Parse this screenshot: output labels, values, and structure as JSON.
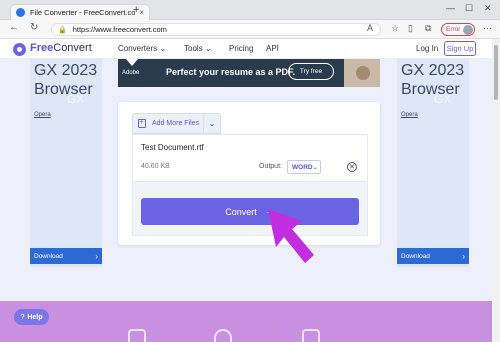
{
  "browser": {
    "tab_title": "File Converter - FreeConvert.com",
    "tab_close": "×",
    "new_tab": "+",
    "minimize": "—",
    "maximize": "☐",
    "close": "✕",
    "back": "←",
    "reload": "↻",
    "lock": "🔒",
    "url": "https://www.freeconvert.com",
    "error_label": "Error",
    "more": "···"
  },
  "header": {
    "logo_prefix": "Free",
    "logo_suffix": "Convert",
    "menu": [
      "Converters ⌄",
      "Tools ⌄",
      "Pricing",
      "API"
    ],
    "login": "Log In",
    "signup": "Sign Up"
  },
  "ads": {
    "left": {
      "title_line1": "GX 2023",
      "title_line2": "Browser",
      "watermark": "GX",
      "brand": "Opera",
      "button": "Download",
      "arrow": "›"
    },
    "right": {
      "title_line1": "GX 2023",
      "title_line2": "Browser",
      "watermark": "GX",
      "brand": "Opera",
      "button": "Download",
      "arrow": "›"
    },
    "banner": {
      "brand": "Adobe",
      "text": "Perfect your resume as a PDF.",
      "button": "Try free"
    }
  },
  "converter": {
    "add_more_label": "Add More Files",
    "add_more_chevron": "⌄",
    "file_name": "Test Document.rtf",
    "file_size": "40.60 KB",
    "output_label": "Output:",
    "output_value": "WORD",
    "output_chevron": "⌄",
    "remove_icon": "✕",
    "convert_label": "Convert",
    "convert_arrow": "→"
  },
  "help": {
    "label": "Help",
    "icon": "?"
  },
  "colors": {
    "brand": "#6a63e4",
    "ad_button": "#2d6ad6",
    "bottom_band": "#c98fe0",
    "pointer": "#c02ee0"
  }
}
